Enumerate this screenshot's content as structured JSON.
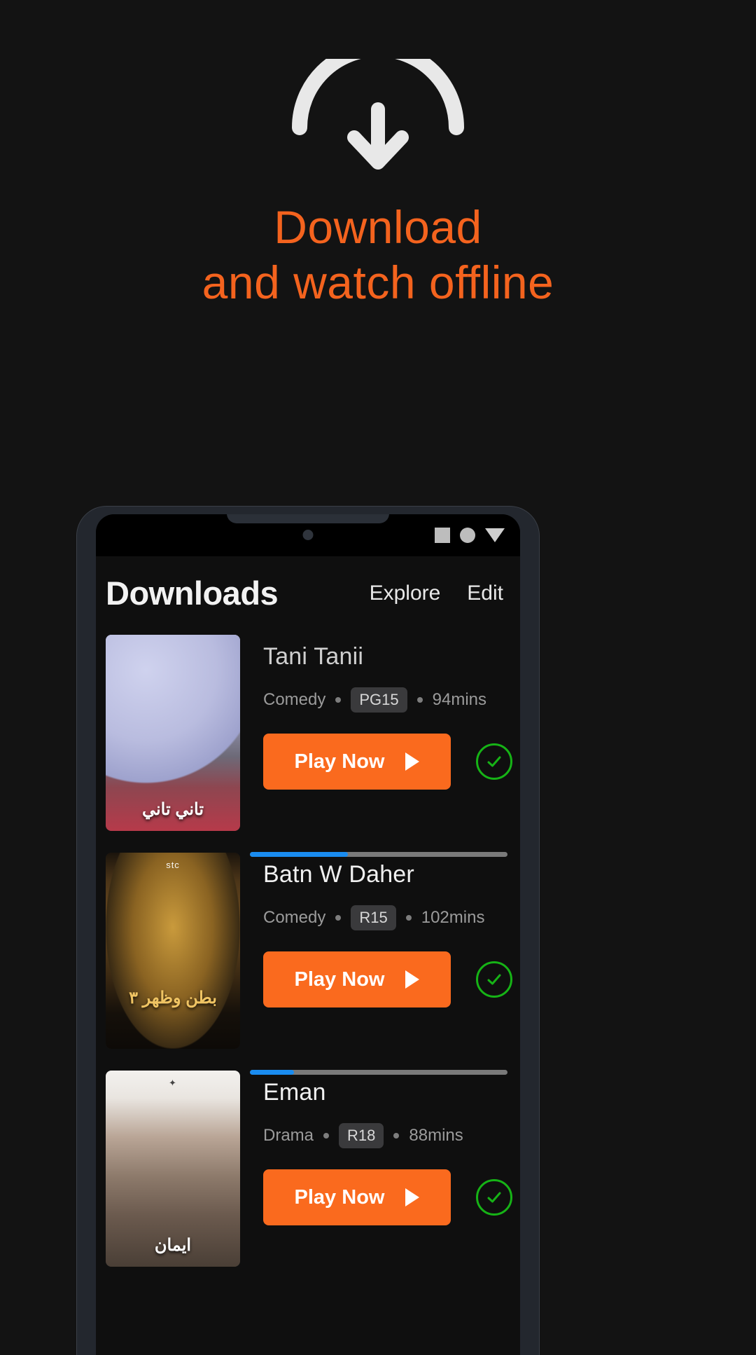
{
  "promo": {
    "icon": "download-arrow-icon",
    "headline_line1": "Download",
    "headline_line2": "and watch offline",
    "accent_color": "#F4631E",
    "background_color": "#131313"
  },
  "phone": {
    "statusbar": {
      "icons": [
        "square-icon",
        "circle-icon",
        "triangle-down-icon"
      ]
    },
    "app": {
      "header": {
        "title": "Downloads",
        "actions": [
          {
            "label": "Explore",
            "name": "explore-button"
          },
          {
            "label": "Edit",
            "name": "edit-button"
          }
        ]
      },
      "play_button_label": "Play Now",
      "play_button_color": "#FA6A1E",
      "progress_color": "#1A8CF0",
      "progress_track_color": "#7A7A7A",
      "check_color": "#16B316",
      "items": [
        {
          "title": "Tani Tanii",
          "genre": "Comedy",
          "rating": "PG15",
          "duration": "94mins",
          "progress_percent": 38,
          "poster_title": "تاني تاني",
          "poster_topmark": "",
          "downloaded": true
        },
        {
          "title": "Batn W Daher",
          "genre": "Comedy",
          "rating": "R15",
          "duration": "102mins",
          "progress_percent": 17,
          "poster_title": "بطن وظهر ٣",
          "poster_topmark": "stc",
          "downloaded": true
        },
        {
          "title": "Eman",
          "genre": "Drama",
          "rating": "R18",
          "duration": "88mins",
          "progress_percent": 0,
          "poster_title": "ايمان",
          "poster_topmark": "",
          "downloaded": true
        }
      ]
    }
  }
}
